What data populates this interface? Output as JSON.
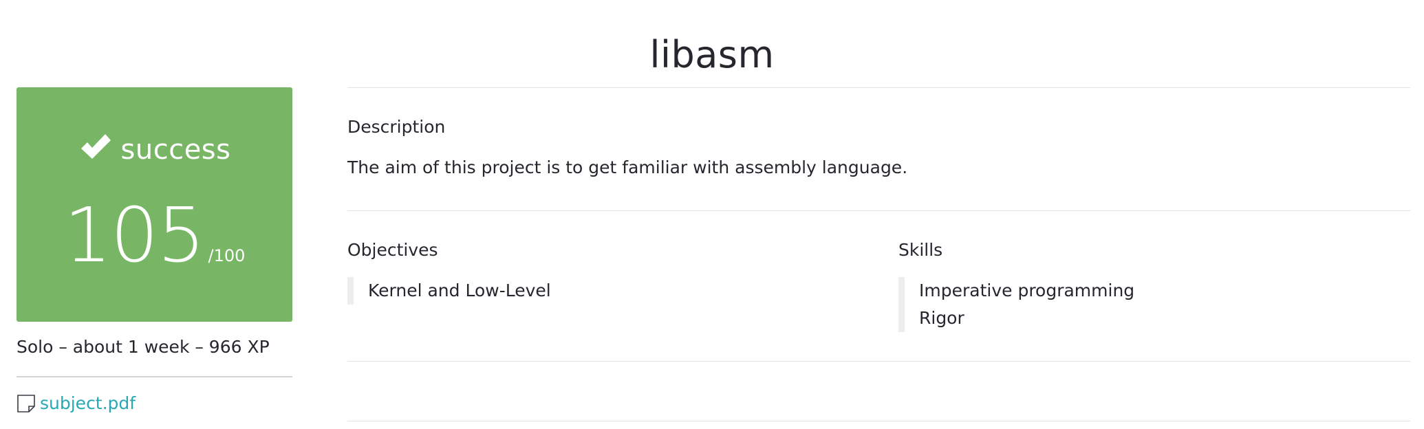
{
  "project": {
    "title": "libasm",
    "status": "success",
    "score": "105",
    "score_max": "/100",
    "meta": "Solo – about 1 week – 966 XP",
    "attachment": "subject.pdf"
  },
  "description": {
    "heading": "Description",
    "text": "The aim of this project is to get familiar with assembly language."
  },
  "objectives": {
    "heading": "Objectives",
    "items": [
      "Kernel and Low-Level"
    ]
  },
  "skills": {
    "heading": "Skills",
    "items": [
      "Imperative programming",
      "Rigor"
    ]
  },
  "colors": {
    "success": "#78b665",
    "link": "#27a9b5"
  },
  "icons": {
    "status": "check-icon",
    "attachment": "document-icon"
  }
}
